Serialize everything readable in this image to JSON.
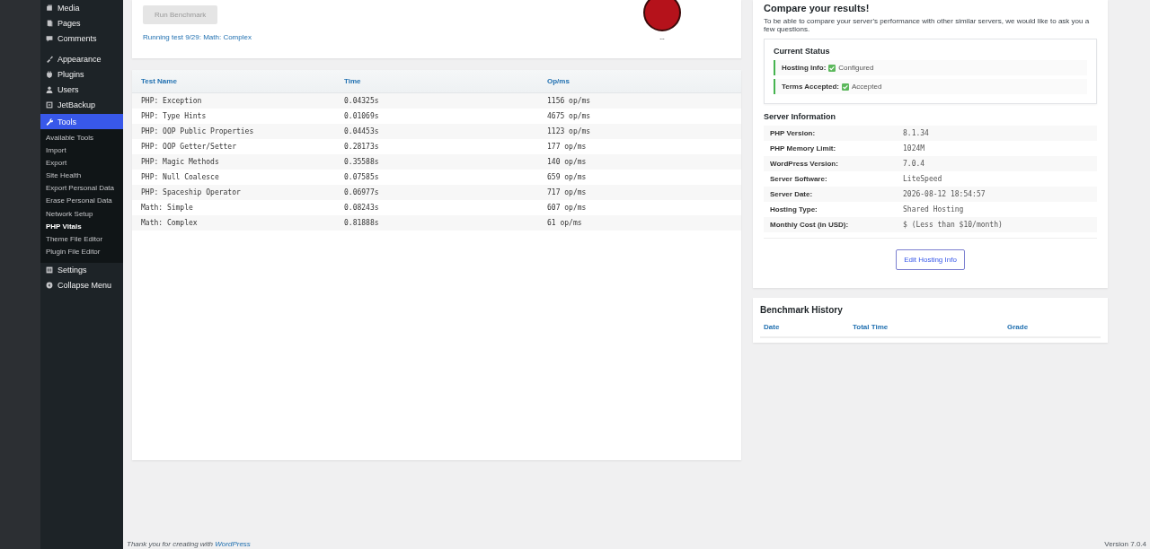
{
  "sidebar": {
    "items": [
      {
        "label": "Media",
        "selected": false
      },
      {
        "label": "Pages",
        "selected": false
      },
      {
        "label": "Comments",
        "selected": false
      },
      {
        "label": "Appearance",
        "selected": false
      },
      {
        "label": "Plugins",
        "selected": false
      },
      {
        "label": "Users",
        "selected": false
      },
      {
        "label": "JetBackup",
        "selected": false
      },
      {
        "label": "Tools",
        "selected": true,
        "children": [
          {
            "label": "Available Tools",
            "selected": false
          },
          {
            "label": "Import",
            "selected": false
          },
          {
            "label": "Export",
            "selected": false
          },
          {
            "label": "Site Health",
            "selected": false
          },
          {
            "label": "Export Personal Data",
            "selected": false
          },
          {
            "label": "Erase Personal Data",
            "selected": false
          },
          {
            "label": "Network Setup",
            "selected": false
          },
          {
            "label": "PHP Vitals",
            "selected": true
          },
          {
            "label": "Theme File Editor",
            "selected": false
          },
          {
            "label": "Plugin File Editor",
            "selected": false
          }
        ]
      },
      {
        "label": "Settings",
        "selected": false
      },
      {
        "label": "Collapse Menu",
        "selected": false
      }
    ]
  },
  "benchmark": {
    "button": {
      "label": "Run Benchmark",
      "disabled": true
    },
    "status": "Running test 9/29: Math: Complex",
    "grade": "--"
  },
  "results": {
    "columns": [
      "Test Name",
      "Time",
      "Op/ms"
    ],
    "rows": [
      [
        "PHP: Exception",
        "0.04325s",
        "1156 op/ms"
      ],
      [
        "PHP: Type Hints",
        "0.01069s",
        "4675 op/ms"
      ],
      [
        "PHP: OOP Public Properties",
        "0.04453s",
        "1123 op/ms"
      ],
      [
        "PHP: OOP Getter/Setter",
        "0.28173s",
        "177 op/ms"
      ],
      [
        "PHP: Magic Methods",
        "0.35588s",
        "140 op/ms"
      ],
      [
        "PHP: Null Coalesce",
        "0.07585s",
        "659 op/ms"
      ],
      [
        "PHP: Spaceship Operator",
        "0.06977s",
        "717 op/ms"
      ],
      [
        "Math: Simple",
        "0.08243s",
        "607 op/ms"
      ],
      [
        "Math: Complex",
        "0.81888s",
        "61 op/ms"
      ]
    ]
  },
  "compare": {
    "title": "Compare your results!",
    "intro": "To be able to compare your server's performance with other similar servers, we would like to ask you a few questions.",
    "status": {
      "title": "Current Status",
      "items": [
        {
          "label": "Hosting Info:",
          "value": "Configured",
          "checked": true
        },
        {
          "label": "Terms Accepted:",
          "value": "Accepted",
          "checked": true
        }
      ]
    },
    "server_title": "Server Information",
    "server": [
      {
        "label": "PHP Version:",
        "value": "8.1.34"
      },
      {
        "label": "PHP Memory Limit:",
        "value": "1024M"
      },
      {
        "label": "WordPress Version:",
        "value": "7.0.4"
      },
      {
        "label": "Server Software:",
        "value": "LiteSpeed"
      },
      {
        "label": "Server Date:",
        "value": "2026-08-12 18:54:57"
      },
      {
        "label": "Hosting Type:",
        "value": "Shared Hosting"
      },
      {
        "label": "Monthly Cost (in USD):",
        "value": "$ (Less than $10/month)"
      }
    ],
    "button": "Edit Hosting Info"
  },
  "history": {
    "title": "Benchmark History",
    "columns": [
      "Date",
      "Total Time",
      "Grade"
    ]
  },
  "footer": {
    "text": "Thank you for creating with",
    "link": "WordPress",
    "version": "Version 7.0.4"
  }
}
